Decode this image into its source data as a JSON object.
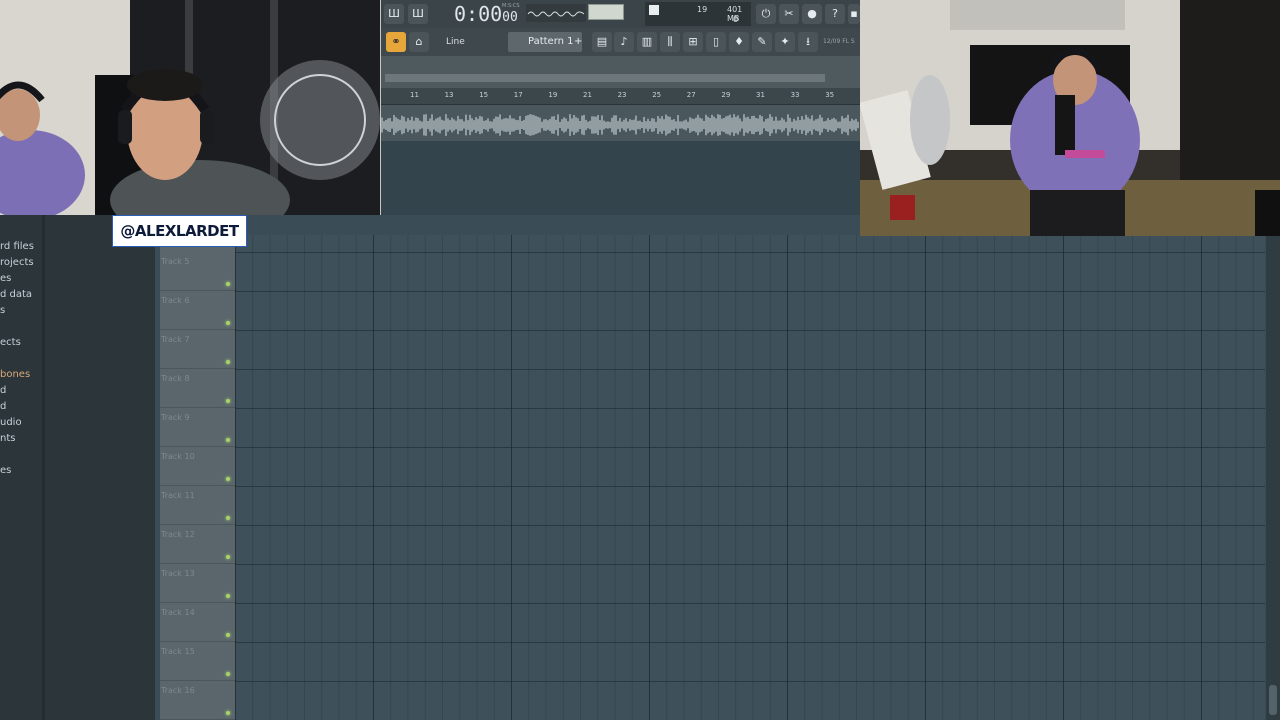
{
  "overlay": {
    "handle": "@ALEXLARDET"
  },
  "browser": {
    "items": [
      {
        "label": "rd files",
        "orange": false
      },
      {
        "label": "rojects",
        "orange": false
      },
      {
        "label": "es",
        "orange": false
      },
      {
        "label": "d data",
        "orange": false
      },
      {
        "label": "s",
        "orange": false
      },
      {
        "label": "",
        "orange": false
      },
      {
        "label": "ects",
        "orange": false
      },
      {
        "label": "",
        "orange": false
      },
      {
        "label": "bones",
        "orange": true
      },
      {
        "label": "d",
        "orange": false
      },
      {
        "label": "d",
        "orange": false
      },
      {
        "label": "udio",
        "orange": false
      },
      {
        "label": "nts",
        "orange": false
      },
      {
        "label": "",
        "orange": false
      },
      {
        "label": "es",
        "orange": false
      }
    ]
  },
  "toolbar": {
    "time_main": "0:00",
    "time_sub": "00",
    "bst_label": "M:S:CS",
    "snap_label": "Line",
    "pattern_label": "Pattern 1",
    "pattern_plus": "+",
    "cpu_value": "19",
    "memory_value": "401 MB",
    "poly_value": "0",
    "version_label": "12/09  FL S"
  },
  "ruler": {
    "ticks": [
      "11",
      "13",
      "15",
      "17",
      "19",
      "21",
      "23",
      "25",
      "27",
      "29",
      "31",
      "33",
      "35"
    ]
  },
  "playlist": {
    "tracks": [
      "Track 5",
      "Track 6",
      "Track 7",
      "Track 8",
      "Track 9",
      "Track 10",
      "Track 11",
      "Track 12",
      "Track 13",
      "Track 14",
      "Track 15",
      "Track 16"
    ]
  },
  "colors": {
    "accent": "#e6a63a",
    "track_led": "#a7d36a",
    "grid_bg": "#3e515b"
  }
}
